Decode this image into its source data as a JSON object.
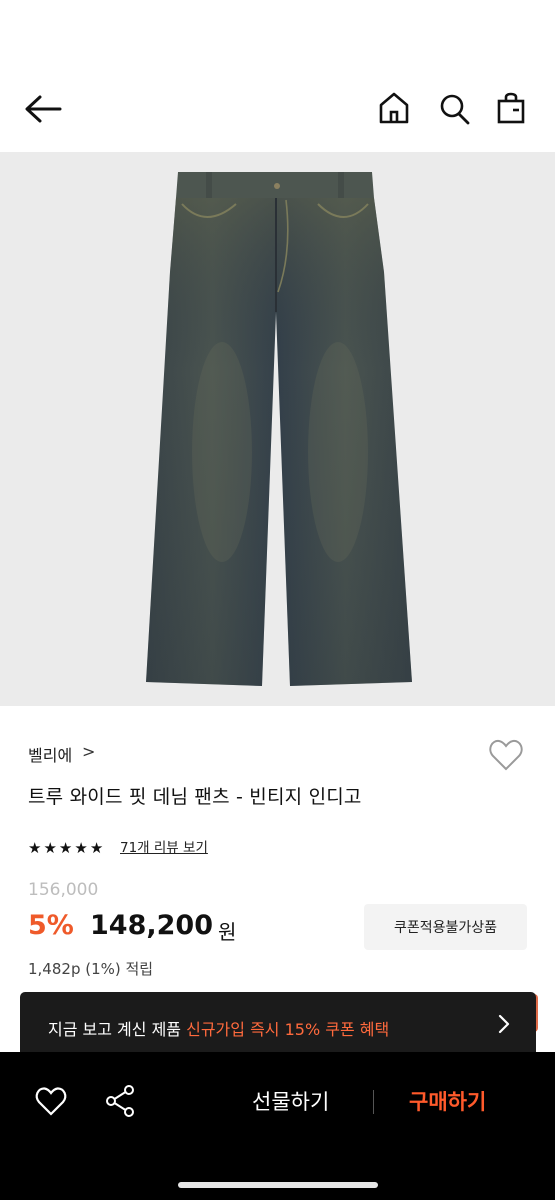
{
  "header": {
    "back_icon": "arrow-left-icon",
    "home_icon": "home-icon",
    "search_icon": "search-icon",
    "bag_icon": "shopping-bag-icon"
  },
  "product": {
    "brand": "벨리에",
    "brand_chevron": ">",
    "title": "트루 와이드 핏 데님 팬츠 - 빈티지 인디고",
    "rating_stars": 5,
    "review_link": "71개 리뷰 보기",
    "original_price": "156,000",
    "discount": "5%",
    "price": "148,200",
    "currency": "원",
    "coupon_button": "쿠폰적용불가상품",
    "points": "1,482p (1%) 적립"
  },
  "toast": {
    "text_plain": "지금 보고 계신 제품 ",
    "text_highlight": "신규가입 즉시 15% 쿠폰 혜택"
  },
  "bottom_bar": {
    "gift_label": "선물하기",
    "buy_label": "구매하기"
  },
  "colors": {
    "accent": "#ef5a2a",
    "toast_bg": "#1b1b1b",
    "bottom_bar_bg": "#000000",
    "image_bg": "#ebebeb"
  }
}
